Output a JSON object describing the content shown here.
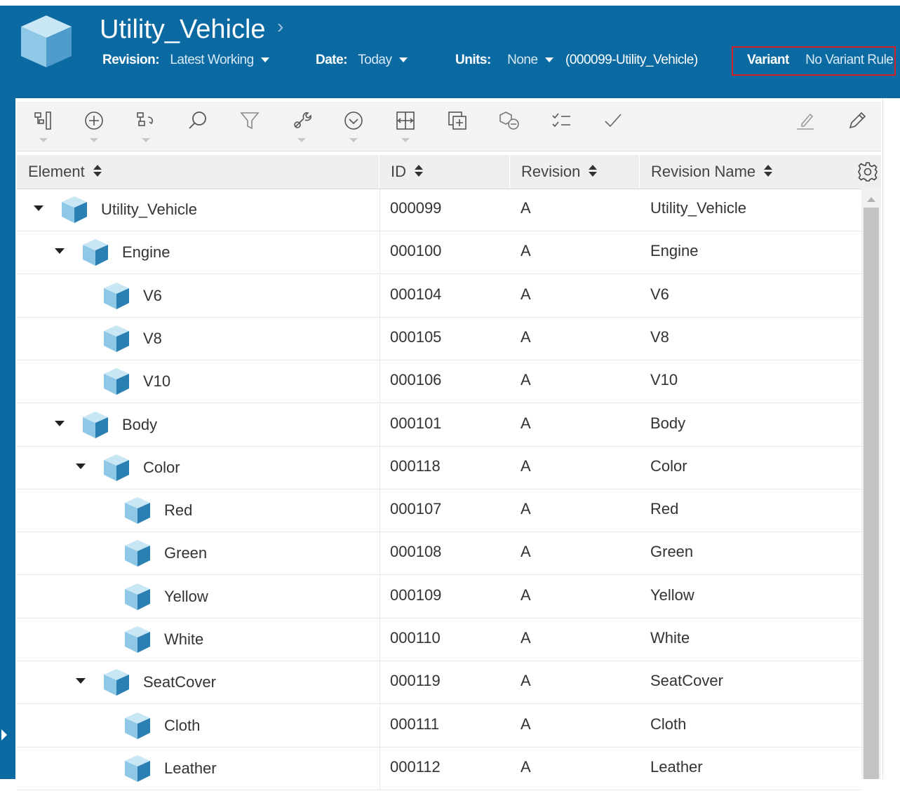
{
  "header": {
    "title": "Utility_Vehicle",
    "chevron": "›",
    "revision_label": "Revision:",
    "revision_value": "Latest Working",
    "date_label": "Date:",
    "date_value": "Today",
    "units_label": "Units:",
    "units_value": "None",
    "context_id": "(000099-Utility_Vehicle)",
    "variant_label": "Variant",
    "variant_value": "No Variant Rule"
  },
  "toolbar": {
    "icons": [
      "structure-icon",
      "add-icon",
      "replace-icon",
      "search-icon",
      "filter-icon",
      "tools-icon",
      "more-icon",
      "split-icon",
      "duplicate-icon",
      "compare-icon",
      "checklist-icon",
      "check-icon",
      "markup-icon",
      "edit-icon"
    ]
  },
  "grid": {
    "columns": [
      "Element",
      "ID",
      "Revision",
      "Revision Name"
    ],
    "rows": [
      {
        "element": "Utility_Vehicle",
        "id": "000099",
        "revision": "A",
        "revision_name": "Utility_Vehicle",
        "level": 0,
        "expanded": true
      },
      {
        "element": "Engine",
        "id": "000100",
        "revision": "A",
        "revision_name": "Engine",
        "level": 1,
        "expanded": true
      },
      {
        "element": "V6",
        "id": "000104",
        "revision": "A",
        "revision_name": "V6",
        "level": 2,
        "expanded": false
      },
      {
        "element": "V8",
        "id": "000105",
        "revision": "A",
        "revision_name": "V8",
        "level": 2,
        "expanded": false
      },
      {
        "element": "V10",
        "id": "000106",
        "revision": "A",
        "revision_name": "V10",
        "level": 2,
        "expanded": false
      },
      {
        "element": "Body",
        "id": "000101",
        "revision": "A",
        "revision_name": "Body",
        "level": 1,
        "expanded": true
      },
      {
        "element": "Color",
        "id": "000118",
        "revision": "A",
        "revision_name": "Color",
        "level": 2,
        "expanded": true
      },
      {
        "element": "Red",
        "id": "000107",
        "revision": "A",
        "revision_name": "Red",
        "level": 3,
        "expanded": false
      },
      {
        "element": "Green",
        "id": "000108",
        "revision": "A",
        "revision_name": "Green",
        "level": 3,
        "expanded": false
      },
      {
        "element": "Yellow",
        "id": "000109",
        "revision": "A",
        "revision_name": "Yellow",
        "level": 3,
        "expanded": false
      },
      {
        "element": "White",
        "id": "000110",
        "revision": "A",
        "revision_name": "White",
        "level": 3,
        "expanded": false
      },
      {
        "element": "SeatCover",
        "id": "000119",
        "revision": "A",
        "revision_name": "SeatCover",
        "level": 2,
        "expanded": true
      },
      {
        "element": "Cloth",
        "id": "000111",
        "revision": "A",
        "revision_name": "Cloth",
        "level": 3,
        "expanded": false
      },
      {
        "element": "Leather",
        "id": "000112",
        "revision": "A",
        "revision_name": "Leather",
        "level": 3,
        "expanded": false
      }
    ]
  },
  "colors": {
    "header_bg": "#0b6aa2",
    "highlight_border": "#d1212a",
    "cube_light": "#8fc8e6",
    "cube_dark": "#2a7fb3"
  }
}
